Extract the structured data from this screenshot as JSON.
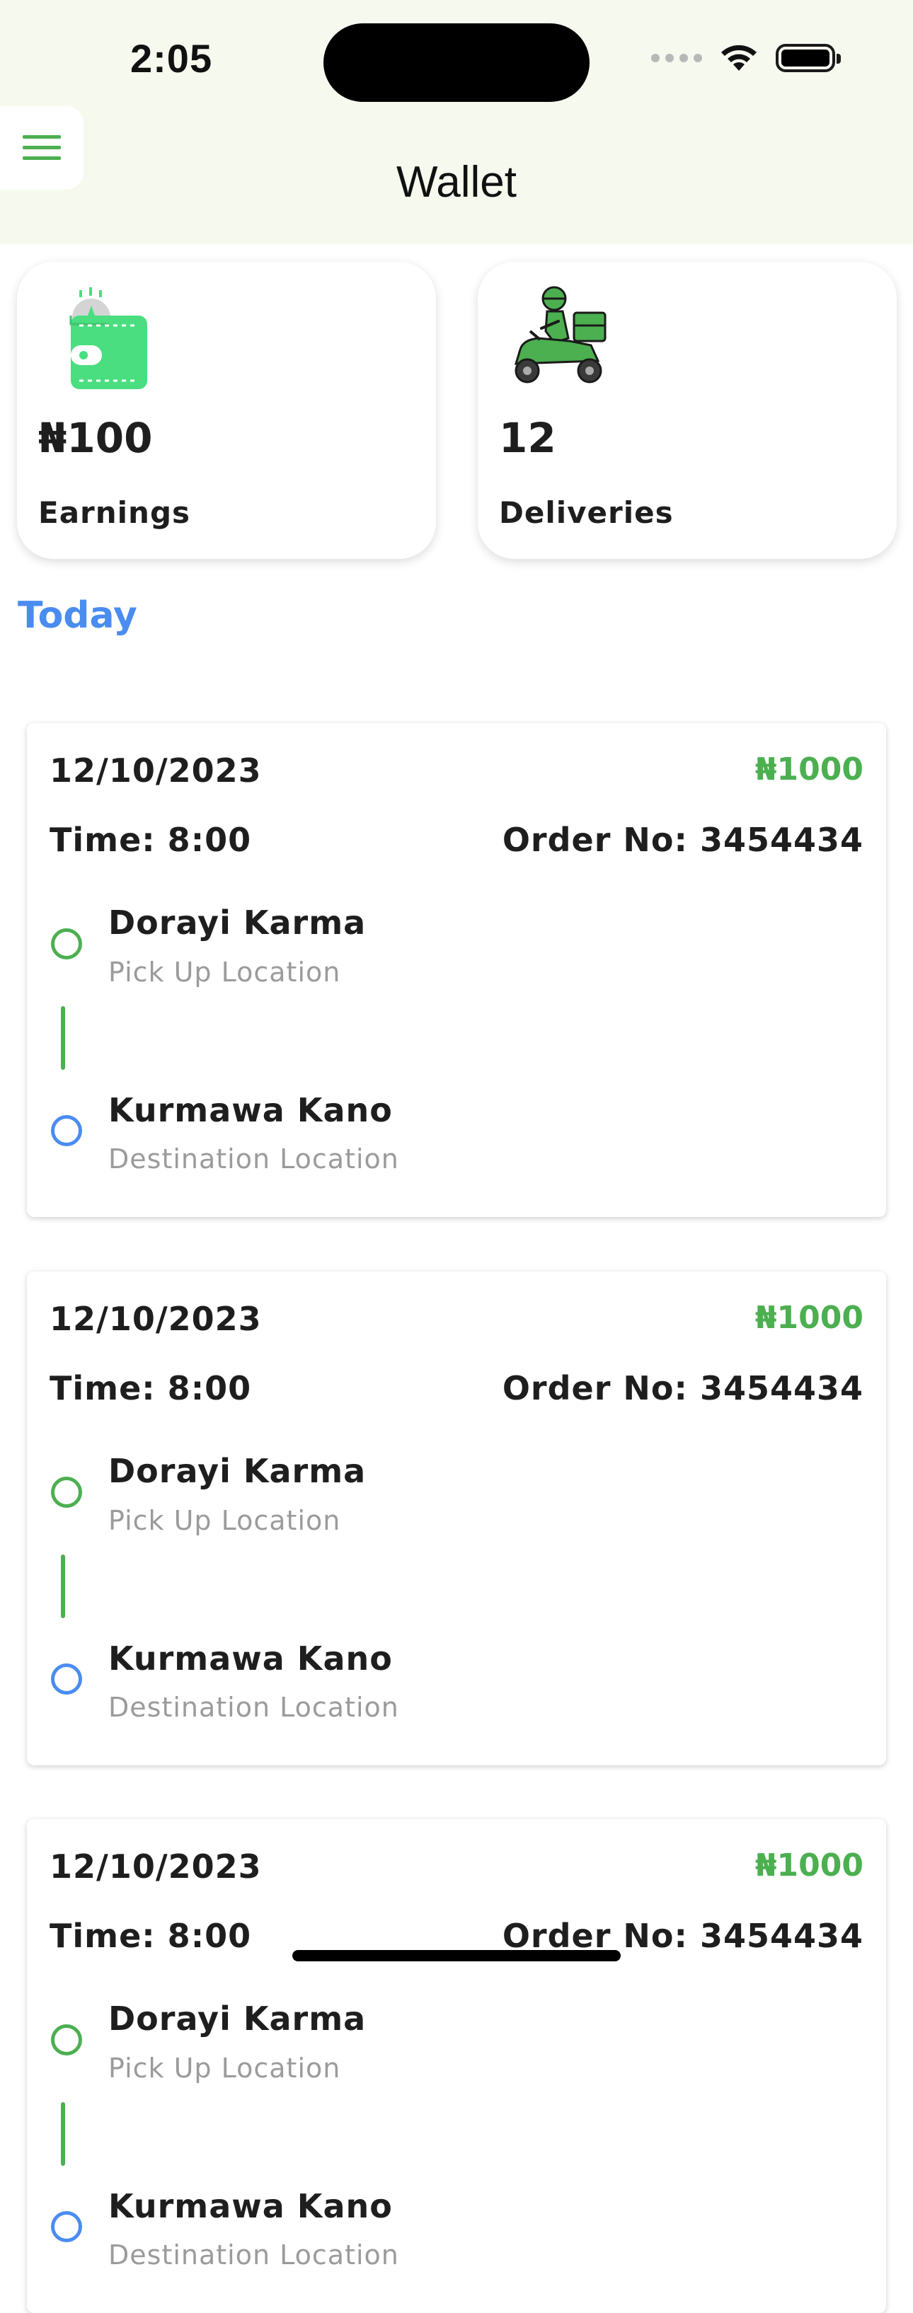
{
  "status_bar": {
    "time": "2:05"
  },
  "header": {
    "title": "Wallet"
  },
  "stats": [
    {
      "value": "₦100",
      "label": "Earnings",
      "icon": "wallet-icon"
    },
    {
      "value": "12",
      "label": "Deliveries",
      "icon": "delivery-scooter-icon"
    }
  ],
  "section": {
    "title": "Today"
  },
  "orders": [
    {
      "date": "12/10/2023",
      "amount": "₦1000",
      "time": "Time: 8:00",
      "order_no": "Order No: 3454434",
      "pickup_name": "Dorayi Karma",
      "pickup_label": "Pick Up Location",
      "dest_name": "Kurmawa Kano",
      "dest_label": "Destination Location"
    },
    {
      "date": "12/10/2023",
      "amount": "₦1000",
      "time": "Time: 8:00",
      "order_no": "Order No: 3454434",
      "pickup_name": "Dorayi Karma",
      "pickup_label": "Pick Up Location",
      "dest_name": "Kurmawa Kano",
      "dest_label": "Destination Location"
    },
    {
      "date": "12/10/2023",
      "amount": "₦1000",
      "time": "Time: 8:00",
      "order_no": "Order No: 3454434",
      "pickup_name": "Dorayi Karma",
      "pickup_label": "Pick Up Location",
      "dest_name": "Kurmawa Kano",
      "dest_label": "Destination Location"
    }
  ],
  "colors": {
    "accent_green": "#4caf50",
    "accent_blue": "#4a8cf0",
    "header_bg": "#f5f9ee"
  }
}
